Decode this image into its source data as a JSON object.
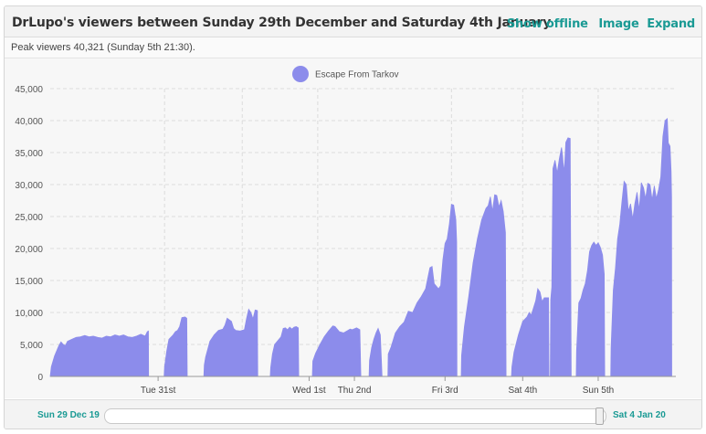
{
  "header": {
    "title": "DrLupo's viewers between Sunday 29th December and Saturday 4th January",
    "show_offline": "Show offline",
    "image": "Image",
    "expand": "Expand"
  },
  "subheader": {
    "peak": "Peak viewers 40,321 (Sunday 5th 21:30)."
  },
  "navigator": {
    "start_label": "Sun 29 Dec 19",
    "end_label": "Sat 4 Jan 20"
  },
  "colors": {
    "series": "#8c8ceb",
    "accent": "#1a9a94"
  },
  "chart_data": {
    "type": "area",
    "series": [
      {
        "name": "Escape From Tarkov",
        "segments": [
          [
            [
              0,
              0
            ],
            [
              0.5,
              1500
            ],
            [
              2,
              3200
            ],
            [
              4,
              4800
            ],
            [
              5,
              5400
            ],
            [
              6,
              5000
            ],
            [
              7,
              4800
            ],
            [
              8,
              5500
            ],
            [
              10,
              5800
            ],
            [
              12,
              6100
            ],
            [
              14,
              6200
            ],
            [
              16,
              6400
            ],
            [
              18,
              6200
            ],
            [
              20,
              6300
            ],
            [
              22,
              6100
            ],
            [
              24,
              6000
            ],
            [
              26,
              6300
            ],
            [
              28,
              6200
            ],
            [
              30,
              6500
            ],
            [
              32,
              6300
            ],
            [
              34,
              6500
            ],
            [
              36,
              6200
            ],
            [
              38,
              6100
            ],
            [
              40,
              6300
            ],
            [
              42,
              6600
            ],
            [
              44,
              6300
            ],
            [
              45,
              7000
            ],
            [
              45.5,
              7100
            ],
            [
              45.6,
              0
            ]
          ],
          [
            [
              52.8,
              0
            ],
            [
              53,
              1500
            ],
            [
              54,
              4000
            ],
            [
              55,
              5800
            ],
            [
              57,
              6500
            ],
            [
              58,
              7000
            ],
            [
              59,
              7200
            ],
            [
              60,
              7800
            ],
            [
              61,
              9200
            ],
            [
              62.5,
              9300
            ],
            [
              63.3,
              9100
            ],
            [
              63.5,
              0
            ]
          ],
          [
            [
              71.2,
              0
            ],
            [
              71.4,
              1800
            ],
            [
              72,
              3000
            ],
            [
              74,
              5500
            ],
            [
              76,
              6500
            ],
            [
              78,
              7200
            ],
            [
              80,
              7400
            ],
            [
              81,
              8000
            ],
            [
              82,
              9100
            ],
            [
              84,
              8600
            ],
            [
              85,
              7500
            ],
            [
              86,
              7200
            ],
            [
              88,
              7100
            ],
            [
              90,
              7300
            ],
            [
              91,
              9000
            ],
            [
              92,
              10500
            ],
            [
              93,
              10000
            ],
            [
              94,
              9000
            ],
            [
              95,
              10400
            ],
            [
              96,
              10300
            ],
            [
              96.2,
              0
            ]
          ],
          [
            [
              102,
              0
            ],
            [
              102.2,
              1400
            ],
            [
              103,
              3500
            ],
            [
              104,
              5000
            ],
            [
              106,
              5800
            ],
            [
              107,
              6200
            ],
            [
              108,
              7500
            ],
            [
              109,
              7600
            ],
            [
              110,
              7300
            ],
            [
              111,
              7700
            ],
            [
              112,
              7400
            ],
            [
              113,
              7700
            ],
            [
              114,
              7800
            ],
            [
              115,
              7600
            ],
            [
              115.2,
              0
            ]
          ],
          [
            [
              121.5,
              0
            ],
            [
              121.7,
              2400
            ],
            [
              123,
              3600
            ],
            [
              125,
              5000
            ],
            [
              127,
              6200
            ],
            [
              129,
              7100
            ],
            [
              131,
              7900
            ],
            [
              132,
              7800
            ],
            [
              133,
              7400
            ],
            [
              134,
              7000
            ],
            [
              136,
              6800
            ],
            [
              138,
              7200
            ],
            [
              139,
              7400
            ],
            [
              140,
              7300
            ],
            [
              142,
              7600
            ],
            [
              143.5,
              7300
            ],
            [
              144,
              0
            ]
          ],
          [
            [
              147.8,
              0
            ],
            [
              148,
              2500
            ],
            [
              149,
              4500
            ],
            [
              150,
              5800
            ],
            [
              151,
              6800
            ],
            [
              152,
              7500
            ],
            [
              153,
              6500
            ],
            [
              153.5,
              2500
            ],
            [
              153.8,
              0
            ]
          ],
          [
            [
              156.5,
              0
            ],
            [
              156.7,
              3500
            ],
            [
              158,
              4600
            ],
            [
              160,
              6800
            ],
            [
              162,
              7800
            ],
            [
              164,
              8500
            ],
            [
              166,
              10200
            ],
            [
              168,
              10000
            ],
            [
              170,
              11500
            ],
            [
              172,
              12500
            ],
            [
              174,
              13700
            ],
            [
              176,
              17000
            ],
            [
              177,
              17200
            ],
            [
              178,
              14500
            ],
            [
              180,
              13700
            ],
            [
              181,
              14200
            ],
            [
              182,
              18200
            ],
            [
              183,
              20800
            ],
            [
              184,
              21500
            ],
            [
              185,
              23800
            ],
            [
              186,
              26900
            ],
            [
              187,
              26800
            ],
            [
              188,
              24500
            ],
            [
              188.4,
              21000
            ],
            [
              188.5,
              0
            ]
          ],
          [
            [
              190.5,
              0
            ],
            [
              190.7,
              3300
            ],
            [
              192,
              7800
            ],
            [
              194,
              12500
            ],
            [
              196,
              17800
            ],
            [
              198,
              21500
            ],
            [
              200,
              24500
            ],
            [
              202,
              26300
            ],
            [
              203,
              26700
            ],
            [
              204,
              28100
            ],
            [
              205,
              25800
            ],
            [
              206,
              28400
            ],
            [
              207,
              28300
            ],
            [
              208,
              26500
            ],
            [
              209,
              27500
            ],
            [
              210,
              25800
            ],
            [
              211,
              22500
            ],
            [
              211.3,
              0
            ]
          ],
          [
            [
              213.8,
              0
            ],
            [
              214,
              1500
            ],
            [
              215,
              3800
            ],
            [
              217,
              6500
            ],
            [
              219,
              8600
            ],
            [
              221,
              9300
            ],
            [
              222,
              10000
            ],
            [
              223,
              9600
            ],
            [
              225,
              11800
            ],
            [
              226,
              13700
            ],
            [
              227,
              13200
            ],
            [
              228,
              11700
            ],
            [
              229,
              12300
            ],
            [
              231,
              12300
            ],
            [
              231.2,
              0
            ]
          ],
          [
            [
              231.8,
              0
            ],
            [
              232,
              12000
            ],
            [
              232.5,
              14000
            ],
            [
              233,
              32500
            ],
            [
              234,
              33800
            ],
            [
              235,
              31800
            ],
            [
              236,
              34000
            ],
            [
              237,
              35800
            ],
            [
              237.5,
              34500
            ],
            [
              238,
              32000
            ],
            [
              238.5,
              33500
            ],
            [
              239,
              36600
            ],
            [
              240,
              37300
            ],
            [
              241,
              37200
            ],
            [
              241.5,
              0
            ]
          ],
          [
            [
              243.8,
              0
            ],
            [
              244,
              4000
            ],
            [
              245,
              11500
            ],
            [
              246,
              12200
            ],
            [
              247,
              13500
            ],
            [
              248,
              14500
            ],
            [
              249,
              16500
            ],
            [
              250,
              19500
            ],
            [
              251,
              20500
            ],
            [
              252,
              21000
            ],
            [
              253,
              20500
            ],
            [
              254,
              20900
            ],
            [
              255,
              20200
            ],
            [
              256,
              19000
            ],
            [
              256.8,
              16000
            ],
            [
              257,
              0
            ]
          ],
          [
            [
              259.8,
              0
            ],
            [
              260,
              4500
            ],
            [
              261,
              13500
            ],
            [
              262,
              17000
            ],
            [
              263,
              21500
            ],
            [
              264,
              23800
            ],
            [
              265,
              27200
            ],
            [
              266,
              30500
            ],
            [
              267,
              30000
            ],
            [
              268,
              25800
            ],
            [
              269,
              27000
            ],
            [
              270,
              24600
            ],
            [
              271,
              27000
            ],
            [
              272,
              28800
            ],
            [
              273,
              26000
            ],
            [
              274,
              30300
            ],
            [
              275,
              29500
            ],
            [
              276,
              27800
            ],
            [
              277,
              30200
            ],
            [
              278,
              30000
            ],
            [
              279,
              27600
            ],
            [
              280,
              29800
            ],
            [
              281,
              27800
            ],
            [
              282,
              29200
            ],
            [
              283,
              31200
            ],
            [
              284,
              37500
            ],
            [
              285,
              40000
            ],
            [
              286,
              40300
            ],
            [
              286.5,
              36500
            ],
            [
              287.3,
              36000
            ],
            [
              287.8,
              32000
            ],
            [
              288,
              28000
            ],
            [
              288.1,
              0
            ]
          ]
        ]
      }
    ],
    "xaxis": {
      "ticks": [
        {
          "x": 50,
          "label": "Tue 31st"
        },
        {
          "x": 120,
          "label": "Wed 1st"
        },
        {
          "x": 141,
          "label": "Thu 2nd"
        },
        {
          "x": 183,
          "label": "Fri 3rd"
        },
        {
          "x": 254,
          "label": "Sun 5th"
        },
        {
          "x": 219,
          "label": "Sat 4th"
        }
      ],
      "grid_x": [
        53,
        89,
        124,
        186,
        219,
        254
      ],
      "xlim": [
        0,
        290
      ]
    },
    "yaxis": {
      "ticks": [
        "0",
        "5,000",
        "10,000",
        "15,000",
        "20,000",
        "25,000",
        "30,000",
        "35,000",
        "40,000",
        "45,000"
      ],
      "tick_values": [
        0,
        5000,
        10000,
        15000,
        20000,
        25000,
        30000,
        35000,
        40000,
        45000
      ],
      "ylim": [
        0,
        45000
      ],
      "grid": true
    },
    "legend": {
      "placement": "top-center"
    }
  }
}
